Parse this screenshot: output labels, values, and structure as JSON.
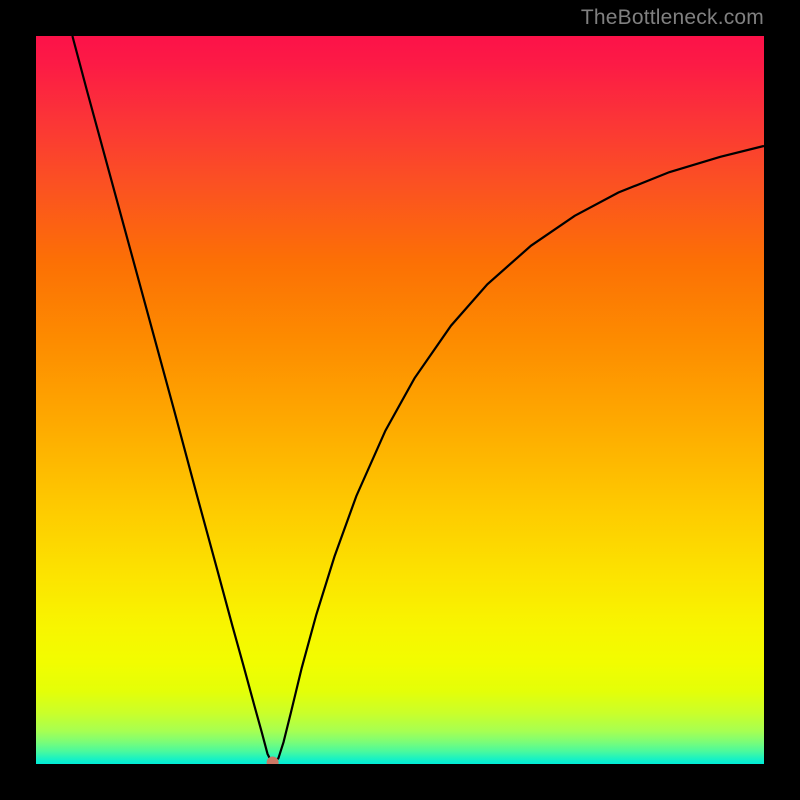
{
  "watermark": "TheBottleneck.com",
  "chart_data": {
    "type": "line",
    "title": "",
    "xlabel": "",
    "ylabel": "",
    "xlim": [
      0,
      100
    ],
    "ylim": [
      0,
      100
    ],
    "grid": false,
    "legend": false,
    "annotations": [],
    "series": [
      {
        "name": "curve",
        "x": [
          5,
          7,
          10,
          13,
          16,
          19,
          22,
          25,
          27,
          28.5,
          30,
          31,
          31.8,
          32.3,
          32.8,
          33.3,
          34,
          35,
          36.5,
          38.5,
          41,
          44,
          48,
          52,
          57,
          62,
          68,
          74,
          80,
          87,
          94,
          100
        ],
        "y": [
          100,
          92.5,
          81.5,
          70.5,
          59.5,
          48.5,
          37.3,
          26.3,
          18.9,
          13.5,
          8.0,
          4.4,
          1.4,
          0.4,
          0.3,
          0.8,
          3.0,
          7.0,
          13.2,
          20.5,
          28.5,
          36.8,
          45.8,
          53.0,
          60.2,
          65.9,
          71.2,
          75.3,
          78.5,
          81.3,
          83.4,
          84.9
        ]
      }
    ],
    "marker": {
      "x": 32.5,
      "y": 0.2
    },
    "background_gradient": {
      "top_color": "#FC1249",
      "bottom_color": "#00ECD8",
      "stops": [
        {
          "pct": 0,
          "color": "#FC1249"
        },
        {
          "pct": 30,
          "color": "#FC7005"
        },
        {
          "pct": 64,
          "color": "#FEC800"
        },
        {
          "pct": 86,
          "color": "#F2FD00"
        },
        {
          "pct": 100,
          "color": "#00ECD8"
        }
      ]
    }
  }
}
